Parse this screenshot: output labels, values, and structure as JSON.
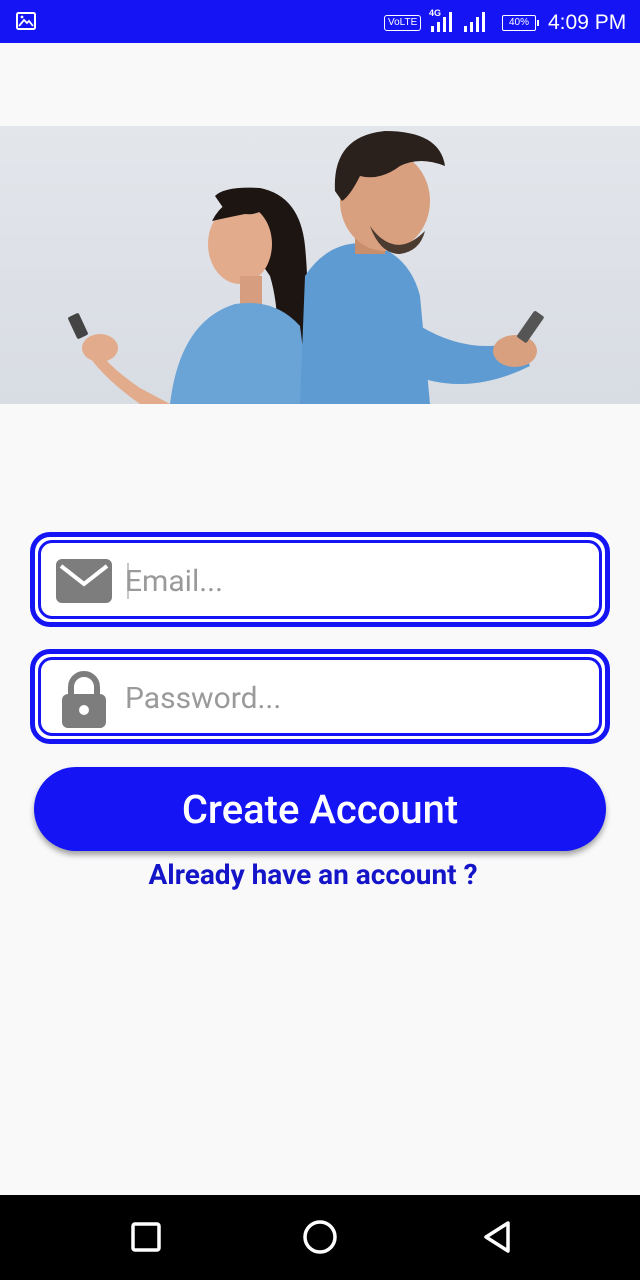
{
  "status_bar": {
    "volte": "VoLTE",
    "network": "4G",
    "battery": "40%",
    "time": "4:09 PM"
  },
  "form": {
    "email_placeholder": "Email...",
    "password_placeholder": "Password...",
    "create_button": "Create Account",
    "login_link": "Already have an account ?"
  },
  "icons": {
    "email": "envelope-icon",
    "password": "lock-icon",
    "nav_recents": "square-icon",
    "nav_home": "circle-icon",
    "nav_back": "triangle-back-icon"
  },
  "colors": {
    "accent": "#1414f5",
    "link": "#1414c8",
    "background": "#f9f9fa"
  }
}
